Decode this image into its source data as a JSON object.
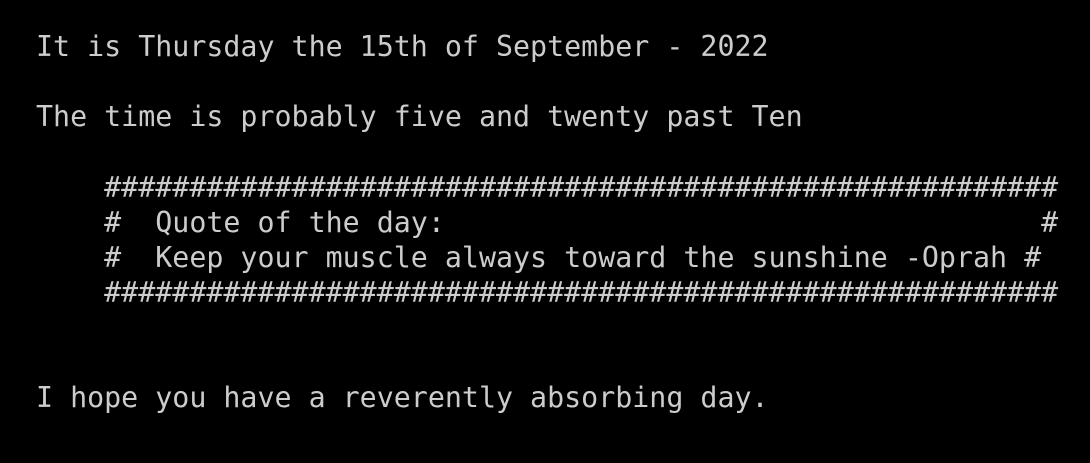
{
  "terminal": {
    "colors": {
      "background": "#000000",
      "text": "#cccccc"
    },
    "date_line": "It is Thursday the 15th of September - 2022",
    "time_line": "The time is probably five and twenty past Ten",
    "quote_box": {
      "border_top": "    ########################################################",
      "header_line": "    #  Quote of the day:                                   #",
      "quote_line": "    #  Keep your muscle always toward the sunshine -Oprah #",
      "border_bottom": "    ########################################################"
    },
    "closing_line": "I hope you have a reverently absorbing day."
  }
}
